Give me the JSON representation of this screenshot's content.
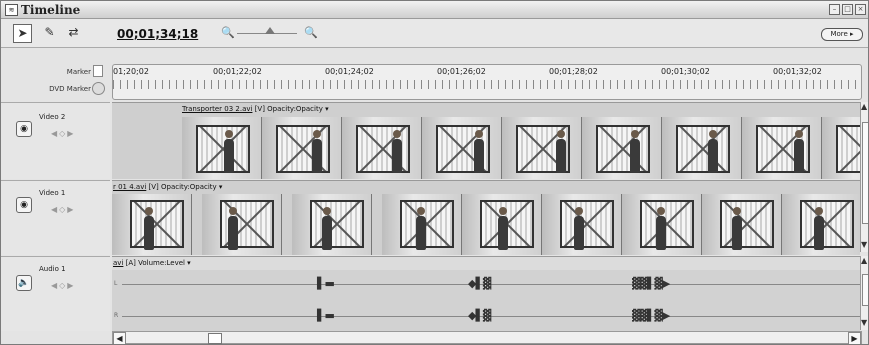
{
  "window": {
    "title": "Timeline",
    "buttons": [
      "–",
      "□",
      "×"
    ]
  },
  "toolbar": {
    "tools": [
      {
        "icon": "arrow-select-icon",
        "glyph": "➤",
        "selected": true
      },
      {
        "icon": "razor-icon",
        "glyph": "✎",
        "selected": false
      },
      {
        "icon": "ripple-edit-icon",
        "glyph": "⇄",
        "selected": false
      }
    ],
    "timecode": "00;01;34;18",
    "zoom_out_glyph": "🔍",
    "zoom_in_glyph": "🔍",
    "more_label": "More ▸"
  },
  "ruler": {
    "marker_label": "Marker",
    "dvd_marker_label": "DVD Marker",
    "ticks": [
      "01;20;02",
      "00;01;22;02",
      "00;01;24;02",
      "00;01;26;02",
      "00;01;28;02",
      "00;01;30;02",
      "00;01;32;02"
    ]
  },
  "tracks": {
    "video2": {
      "name": "Video 2",
      "clip_name": "Transporter 03 2.avi",
      "clip_suffix": " [V]  Opacity:Opacity ▾"
    },
    "video1": {
      "name": "Video 1",
      "clip_name": "r 01 4.avi",
      "clip_suffix": " [V]  Opacity:Opacity ▾"
    },
    "audio1": {
      "name": "Audio 1",
      "clip_name": "avi",
      "clip_suffix": " [A]  Volume:Level ▾",
      "channels": [
        "L",
        "R"
      ]
    }
  }
}
